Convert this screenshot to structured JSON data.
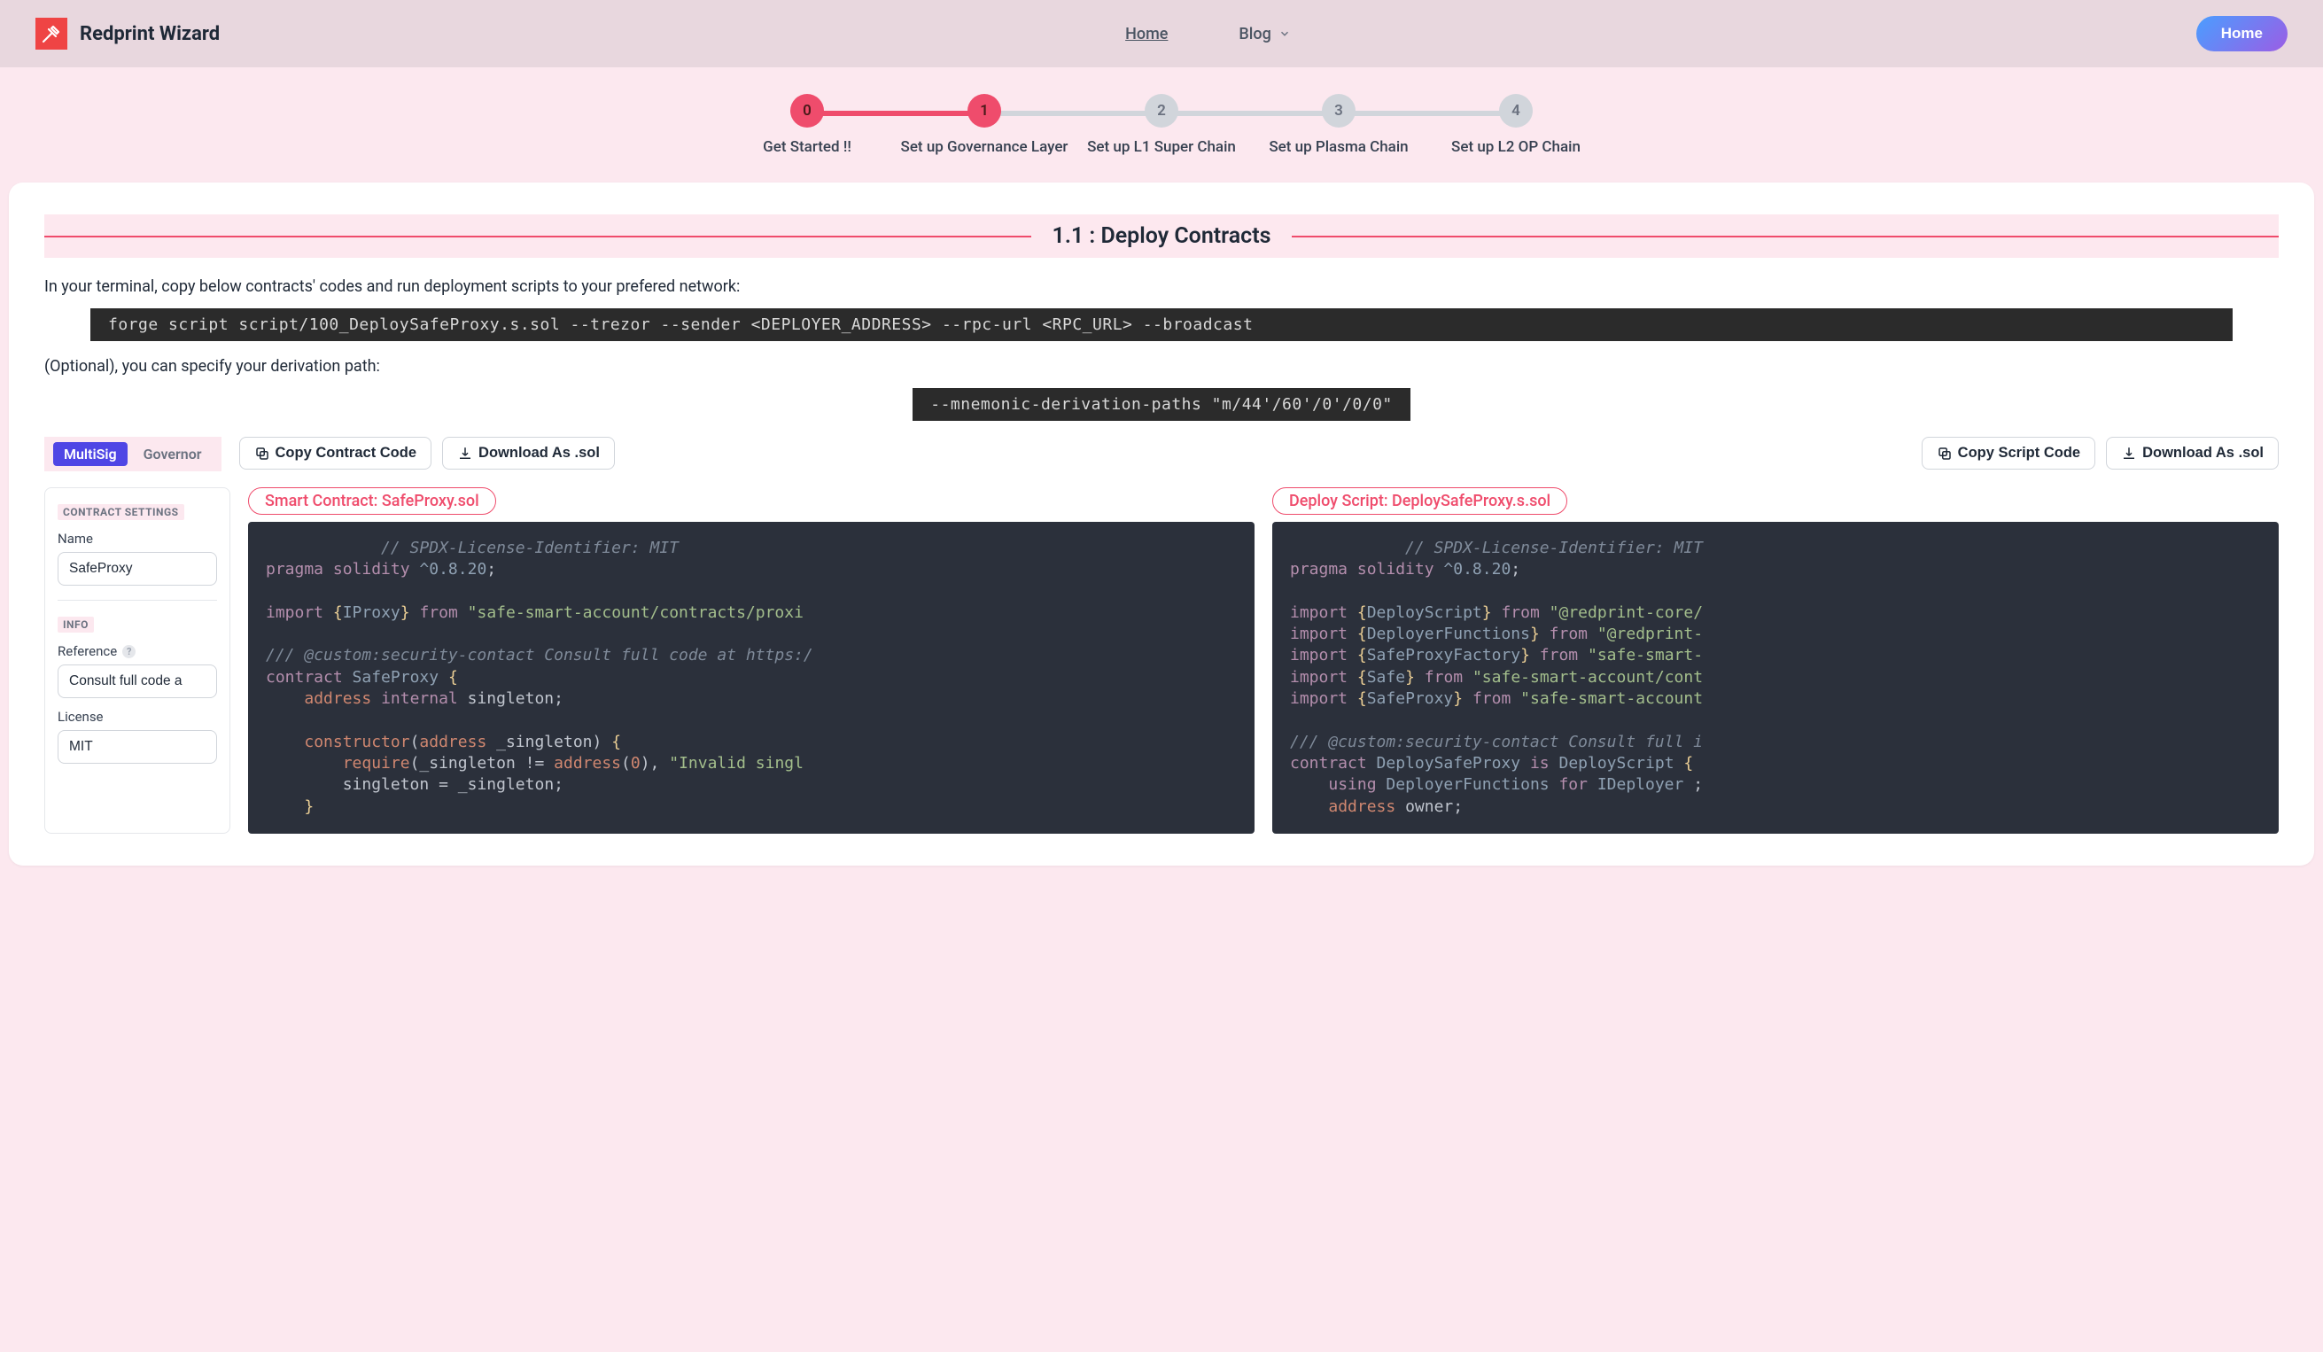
{
  "brand": {
    "name": "Redprint Wizard"
  },
  "nav": {
    "home": "Home",
    "blog": "Blog"
  },
  "cta": {
    "home": "Home"
  },
  "steps": [
    {
      "num": "0",
      "label": "Get Started !!",
      "state": "active",
      "line": "done"
    },
    {
      "num": "1",
      "label": "Set up Governance Layer",
      "state": "active",
      "line": "todo"
    },
    {
      "num": "2",
      "label": "Set up L1 Super Chain",
      "state": "inactive",
      "line": "todo"
    },
    {
      "num": "3",
      "label": "Set up Plasma Chain",
      "state": "inactive",
      "line": "todo"
    },
    {
      "num": "4",
      "label": "Set up L2 OP Chain",
      "state": "inactive",
      "line": "none"
    }
  ],
  "section": {
    "title": "1.1 : Deploy Contracts"
  },
  "intro": {
    "p1": "In your terminal, copy below contracts' codes and run deployment scripts to your prefered network:",
    "cmd1": "forge script script/100_DeploySafeProxy.s.sol --trezor --sender <DEPLOYER_ADDRESS> --rpc-url <RPC_URL> --broadcast",
    "p2": "(Optional), you can specify your derivation path:",
    "cmd2": "--mnemonic-derivation-paths \"m/44'/60'/0'/0/0\""
  },
  "tabs": {
    "multisig": "MultiSig",
    "governor": "Governor"
  },
  "buttons": {
    "copyContract": "Copy Contract Code",
    "downloadContract": "Download As .sol",
    "copyScript": "Copy Script Code",
    "downloadScript": "Download As .sol"
  },
  "settings": {
    "hdr1": "CONTRACT SETTINGS",
    "nameLabel": "Name",
    "nameValue": "SafeProxy",
    "hdr2": "INFO",
    "refLabel": "Reference",
    "refValue": "Consult full code a",
    "licLabel": "License",
    "licValue": "MIT"
  },
  "codes": {
    "contractBadge": "Smart Contract: SafeProxy.sol",
    "scriptBadge": "Deploy Script: DeploySafeProxy.s.sol"
  }
}
